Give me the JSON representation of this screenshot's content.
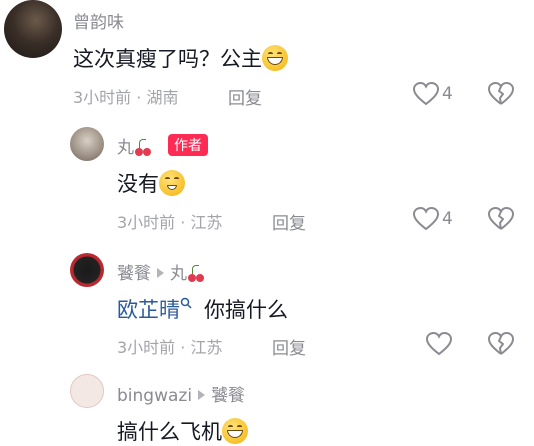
{
  "comments": [
    {
      "user": "曾韵味",
      "text": "这次真瘦了吗？公主",
      "time_location": "3小时前 · 湖南",
      "reply_label": "回复",
      "likes": "4"
    },
    {
      "user": "丸",
      "badge": "作者",
      "text": "没有",
      "time_location": "3小时前 · 江苏",
      "reply_label": "回复",
      "likes": "4"
    },
    {
      "user": "饕餮",
      "reply_to": "丸",
      "mention": "欧芷晴",
      "text": "你搞什么",
      "time_location": "3小时前 · 江苏",
      "reply_label": "回复",
      "likes": ""
    },
    {
      "user": "bingwazi",
      "reply_to": "饕餮",
      "text": "搞什么飞机"
    }
  ],
  "icons": {
    "like": "heart-outline-icon",
    "dislike": "broken-heart-icon",
    "reply_arrow": "triangle-right-icon",
    "emoji": "grinning-emoji-icon",
    "cherry": "cherry-icon"
  },
  "colors": {
    "author_badge": "#fe2c55",
    "mention": "#2a5a9c",
    "meta": "#a3a4a9"
  }
}
